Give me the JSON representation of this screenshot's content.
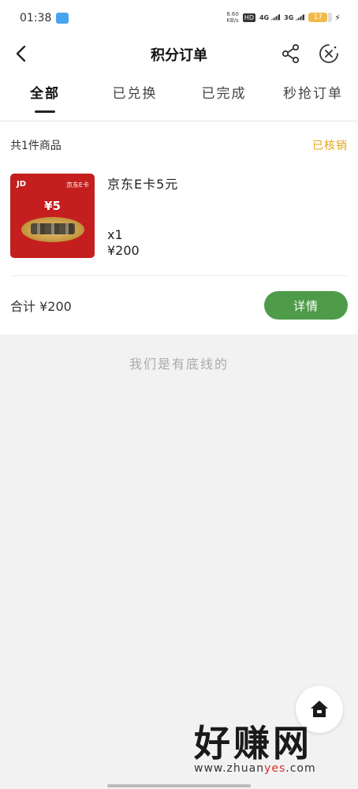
{
  "status_bar": {
    "time": "01:38",
    "speed_value": "8.60",
    "speed_unit": "KB/s",
    "hd": "HD",
    "net1": "4G",
    "net2": "3G",
    "battery": "17"
  },
  "nav": {
    "title": "积分订单",
    "icons": [
      "back-icon",
      "share-icon",
      "close-icon"
    ]
  },
  "tabs": [
    {
      "label": "全部",
      "active": true
    },
    {
      "label": "已兑换",
      "active": false
    },
    {
      "label": "已完成",
      "active": false
    },
    {
      "label": "秒抢订单",
      "active": false
    }
  ],
  "order": {
    "count_text": "共1件商品",
    "status": "已核销",
    "product": {
      "name": "京东E卡5元",
      "quantity": "x1",
      "price": "¥200",
      "thumb": {
        "brand": "JD",
        "card_label": "京东E卡",
        "amount": "¥5"
      }
    },
    "total": "合计 ¥200",
    "detail_button": "详情"
  },
  "bottom_line": "我们是有底线的",
  "watermark": {
    "big": "好赚网",
    "small_pre": "www.zhuan",
    "small_hl": "yes",
    "small_post": ".com"
  },
  "colors": {
    "accent_green": "#4e9b4a",
    "status_yellow": "#e7a615",
    "card_red": "#c41e1e"
  }
}
